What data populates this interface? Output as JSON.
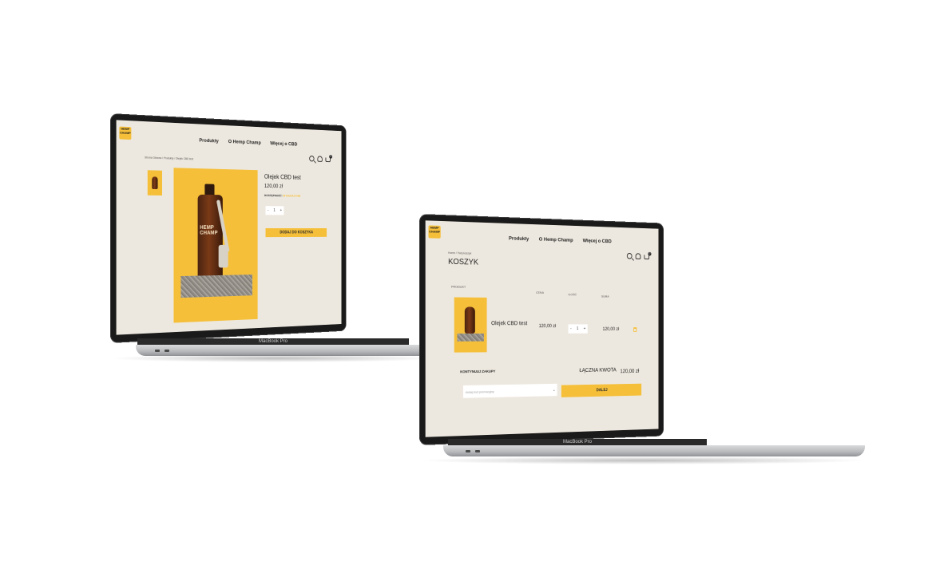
{
  "nav": {
    "items": [
      "Produkty",
      "O Hemp Champ",
      "Więcej o CBD"
    ],
    "cart_count": "0"
  },
  "logo": {
    "text": "HEMP CHAMP"
  },
  "left_screen": {
    "breadcrumb": "Strona Główna  /  Produkty  /  Olejek CBD test",
    "product_title": "Olejek CBD test",
    "price": "120,00 zł",
    "availability_label": "DOSTĘPNOŚĆ:",
    "availability_value": "W MAGAZYNIE",
    "qty_minus": "-",
    "qty_value": "1",
    "qty_plus": "+",
    "add_to_cart": "DODAJ DO KOSZYKA",
    "bottle_brand": "HEMP CHAMP"
  },
  "right_screen": {
    "breadcrumb": "Home  /  Twój koszyk",
    "page_title": "KOSZYK",
    "col_product": "PRODUKT",
    "col_price": "CENA",
    "col_qty": "ILOŚĆ",
    "col_total": "SUMA",
    "item_name": "Olejek CBD test",
    "item_price": "120,00 zł",
    "qty_minus": "-",
    "qty_value": "1",
    "qty_plus": "+",
    "item_total": "120,00 zł",
    "continue_shopping": "KONTYNUUJ ZAKUPY",
    "total_label": "ŁĄCZNA KWOTA",
    "total_value": "120,00 zł",
    "promo_placeholder": "dodaj kod promocyjny",
    "promo_plus": "+",
    "next_button": "DALEJ"
  },
  "device": {
    "model": "MacBook Pro"
  },
  "colors": {
    "accent": "#f5bf3a",
    "screen_bg": "#ede8df",
    "bezel": "#1a1a1a"
  }
}
